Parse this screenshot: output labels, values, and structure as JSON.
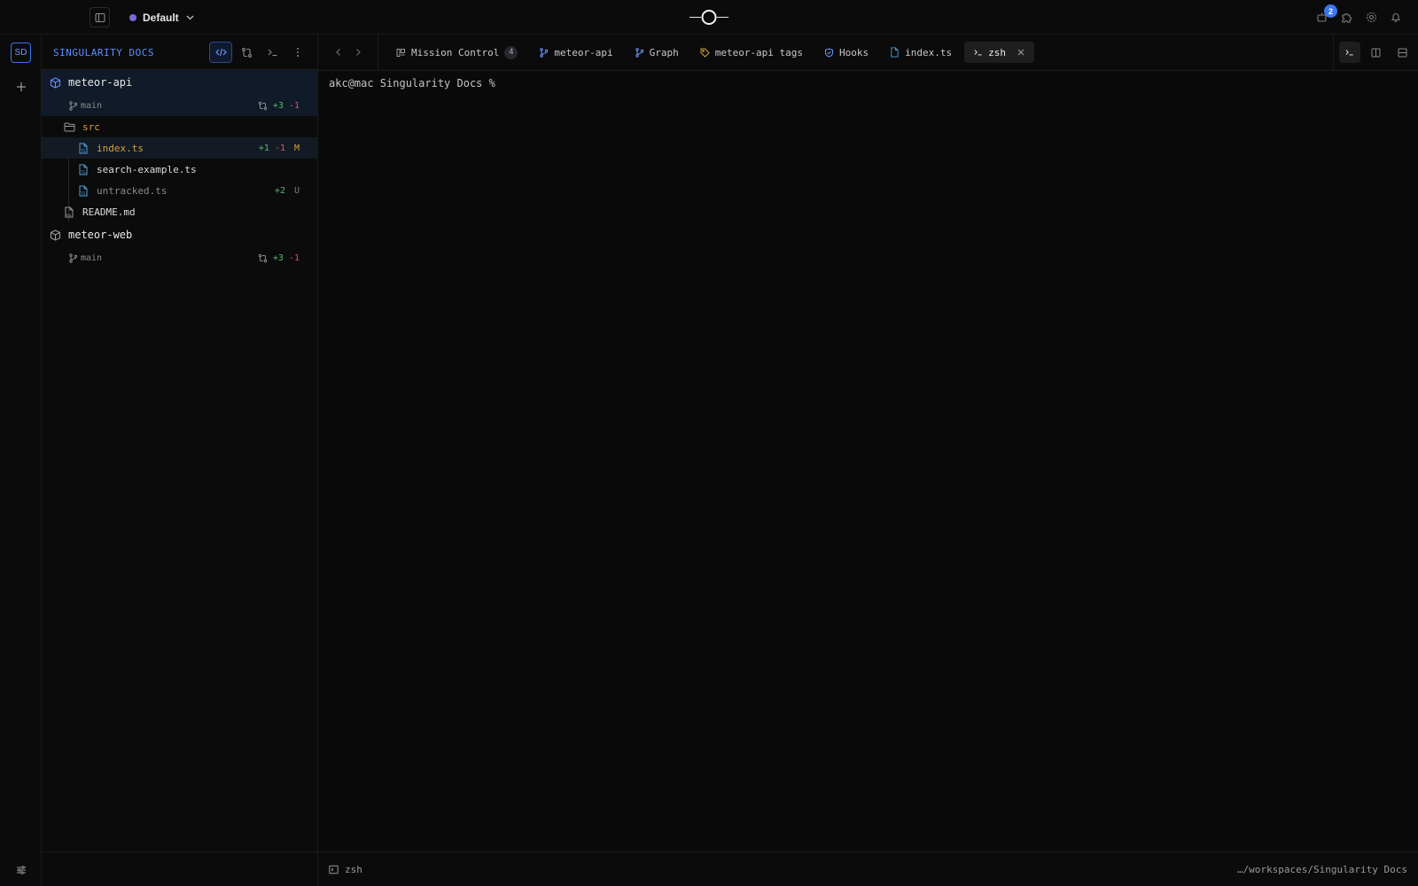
{
  "workspace": {
    "name": "Default",
    "dot_color": "#7c6bd6"
  },
  "notifications": {
    "count": "2"
  },
  "rail": {
    "avatar": "SD"
  },
  "explorer": {
    "title": "SINGULARITY DOCS",
    "repos": [
      {
        "name": "meteor-api",
        "branch": "main",
        "added": "+3",
        "removed": "-1",
        "folder": "src",
        "files": [
          {
            "name": "index.ts",
            "added": "+1",
            "removed": "-1",
            "status": "M"
          },
          {
            "name": "search-example.ts"
          },
          {
            "name": "untracked.ts",
            "added": "+2",
            "status": "U"
          }
        ],
        "root_file": "README.md"
      },
      {
        "name": "meteor-web",
        "branch": "main",
        "added": "+3",
        "removed": "-1"
      }
    ]
  },
  "tabs": [
    {
      "label": "Mission Control",
      "count": "4",
      "icon": "mission-control-icon"
    },
    {
      "label": "meteor-api",
      "icon": "git-branch-icon"
    },
    {
      "label": "Graph",
      "icon": "git-branch-icon"
    },
    {
      "label": "meteor-api tags",
      "icon": "tag-icon"
    },
    {
      "label": "Hooks",
      "icon": "shield-icon"
    },
    {
      "label": "index.ts",
      "icon": "typescript-file-icon"
    },
    {
      "label": "zsh",
      "icon": "terminal-icon",
      "active": true
    }
  ],
  "terminal": {
    "prompt": "akc@mac Singularity Docs %"
  },
  "statusbar": {
    "shell": "zsh",
    "path": "…/workspaces/Singularity Docs"
  },
  "colors": {
    "accent": "#3b76f0",
    "added": "#4fbf6c",
    "removed": "#e0575b",
    "modified": "#d4a13a"
  }
}
